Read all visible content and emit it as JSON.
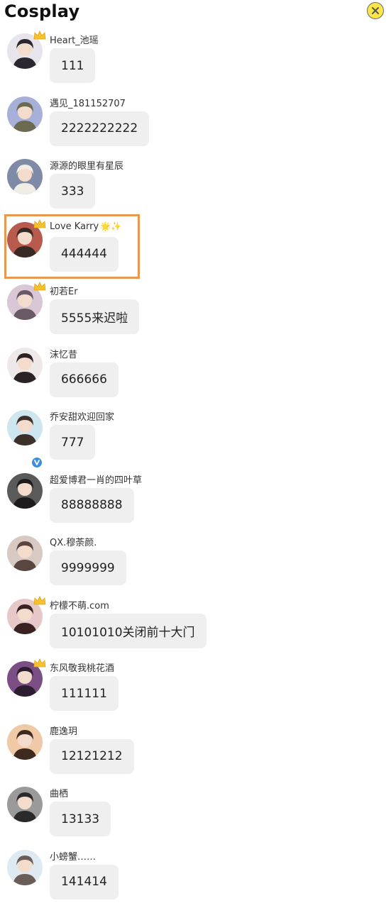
{
  "header": {
    "title": "Cosplay",
    "close_icon": "close-icon"
  },
  "messages": [
    {
      "username": "Heart_池瑶",
      "text": "111",
      "crown": true,
      "avatar_color": "#e8e4ec",
      "avatar_accent": "#2b2730"
    },
    {
      "username": "遇见_181152707",
      "text": "2222222222",
      "crown": false,
      "avatar_color": "#a7b0d8",
      "avatar_accent": "#6d6a52"
    },
    {
      "username": "源源的眼里有星辰",
      "text": "333",
      "crown": false,
      "avatar_color": "#7e8aa6",
      "avatar_accent": "#f0ece6"
    },
    {
      "username": "Love Karry",
      "suffix": "🌟✨",
      "text": "444444",
      "crown": true,
      "highlight": true,
      "avatar_color": "#b85a4e",
      "avatar_accent": "#3a2a26"
    },
    {
      "username": "初若Er",
      "text": "5555来迟啦",
      "crown": true,
      "avatar_color": "#d9c7d6",
      "avatar_accent": "#6a5a66"
    },
    {
      "username": "沫忆昔",
      "text": "666666",
      "crown": false,
      "avatar_color": "#efe8e8",
      "avatar_accent": "#2a2224"
    },
    {
      "username": "乔安甜欢迎回家",
      "text": "777",
      "crown": false,
      "verified": true,
      "avatar_color": "#cde6f0",
      "avatar_accent": "#3d2f2a"
    },
    {
      "username": "超爱博君一肖的四叶草",
      "text": "88888888",
      "crown": false,
      "avatar_color": "#5b5a5a",
      "avatar_accent": "#1d1b1b"
    },
    {
      "username": "QX.穆荼颜.",
      "text": "9999999",
      "crown": false,
      "avatar_color": "#d9c9c3",
      "avatar_accent": "#5a4640"
    },
    {
      "username": "柠檬不萌.com",
      "text": "10101010关闭前十大门",
      "crown": true,
      "avatar_color": "#e7c8c8",
      "avatar_accent": "#3a2222"
    },
    {
      "username": "东风敬我桃花酒",
      "text": "111111",
      "crown": true,
      "avatar_color": "#7b4f86",
      "avatar_accent": "#2c1e30"
    },
    {
      "username": "鹿逸玥",
      "text": "12121212",
      "crown": false,
      "avatar_color": "#f0c9a6",
      "avatar_accent": "#3e2a20"
    },
    {
      "username": "曲栖",
      "text": "13133",
      "crown": false,
      "avatar_color": "#9a9a9a",
      "avatar_accent": "#2a2a2a"
    },
    {
      "username": "小螃蟹……",
      "text": "141414",
      "crown": false,
      "avatar_color": "#dfe9f2",
      "avatar_accent": "#6a5d57"
    }
  ]
}
